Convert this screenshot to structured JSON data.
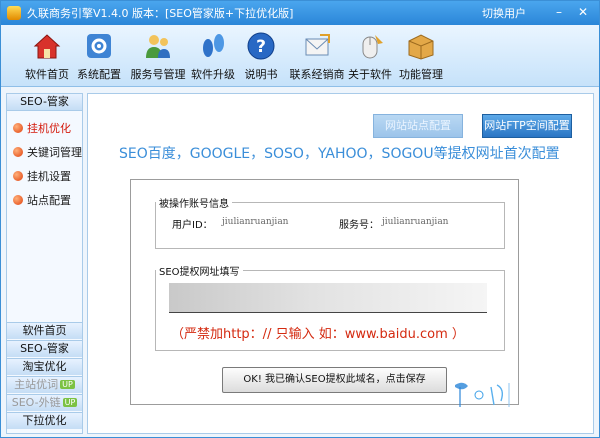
{
  "window": {
    "title": "久联商务引擎V1.4.0  版本：[SEO管家版+下拉优化版]",
    "switch_user": "切换用户",
    "minimize": "–",
    "close": "✕"
  },
  "toolbar": {
    "items": [
      {
        "label": "软件首页",
        "icon": "home-icon"
      },
      {
        "label": "系统配置",
        "icon": "system-config-icon"
      },
      {
        "label": "服务号管理",
        "icon": "users-icon"
      },
      {
        "label": "软件升级",
        "icon": "footprints-icon"
      },
      {
        "label": "说明书",
        "icon": "help-icon"
      },
      {
        "label": "联系经销商",
        "icon": "contact-icon"
      },
      {
        "label": "关于软件",
        "icon": "mouse-icon"
      },
      {
        "label": "功能管理",
        "icon": "box-icon"
      }
    ]
  },
  "sidebar": {
    "header": "SEO-管家",
    "items": [
      {
        "label": "挂机优化"
      },
      {
        "label": "关键词管理"
      },
      {
        "label": "挂机设置"
      },
      {
        "label": "站点配置"
      }
    ],
    "bottom": [
      {
        "label": "软件首页"
      },
      {
        "label": "SEO-管家"
      },
      {
        "label": "淘宝优化"
      },
      {
        "label": "主站优词",
        "badge": "UP"
      },
      {
        "label": "SEO-外链",
        "badge": "UP"
      },
      {
        "label": "下拉优化"
      }
    ]
  },
  "main": {
    "btn_site_config": "网站站点配置",
    "btn_ftp_config": "网站FTP空间配置",
    "heading": "SEO百度，GOOGLE，SOSO，YAHOO，SOGOU等提权网址首次配置",
    "account_legend": "被操作账号信息",
    "user_id_label": "用户ID：",
    "user_id_value": "jiulianruanjian",
    "service_label": "服务号：",
    "service_value": "jiulianruanjian",
    "url_legend": "SEO提权网址填写",
    "url_input_value": "",
    "warning": "（严禁加http：//  只输入 如：www.baidu.com ）",
    "save_button": "OK!   我已确认SEO提权此域名，点击保存"
  },
  "colors": {
    "accent": "#2b86d8",
    "heading": "#3a8ed9",
    "warning": "#d42a10"
  }
}
